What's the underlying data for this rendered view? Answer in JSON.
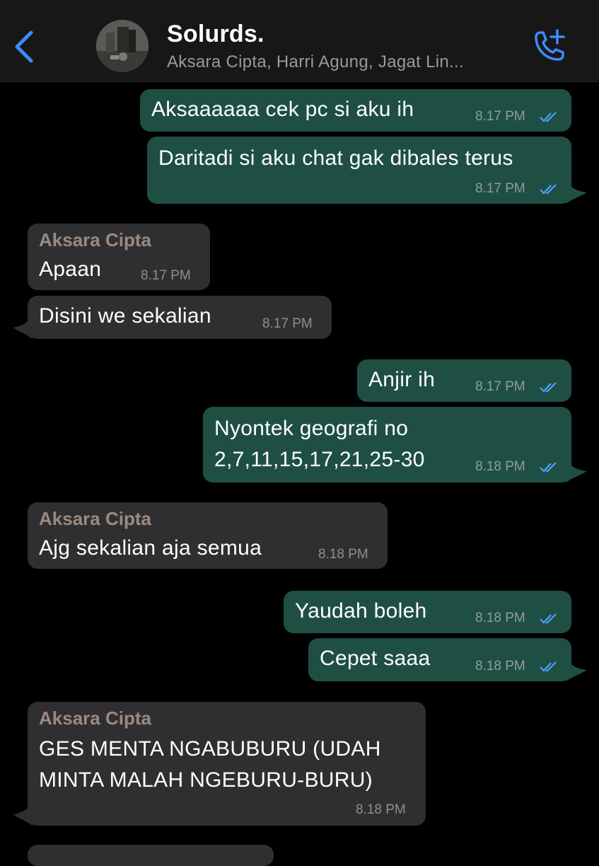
{
  "header": {
    "back_icon": "chevron-left-icon",
    "title": "Solurds.",
    "subtitle": "Aksara Cipta, Harri Agung, Jagat Lin...",
    "call_icon": "phone-plus-icon"
  },
  "colors": {
    "outgoing_bubble": "#1f4f43",
    "incoming_bubble": "#2f2f31",
    "sender_name": "#9b8a80",
    "accent": "#3d8bff"
  },
  "messages": [
    {
      "direction": "out",
      "text": "Aksaaaaaa cek pc si aku ih",
      "time": "8.17 PM",
      "status": "read"
    },
    {
      "direction": "out",
      "text": "Daritadi si aku chat gak dibales terus",
      "time": "8.17 PM",
      "status": "read"
    },
    {
      "direction": "in",
      "sender": "Aksara Cipta",
      "text": "Apaan",
      "time": "8.17 PM"
    },
    {
      "direction": "in",
      "text": "Disini we sekalian",
      "time": "8.17 PM"
    },
    {
      "direction": "out",
      "text": "Anjir ih",
      "time": "8.17 PM",
      "status": "read"
    },
    {
      "direction": "out",
      "text_lines": [
        "Nyontek geografi no",
        "2,7,11,15,17,21,25-30"
      ],
      "time": "8.18 PM",
      "status": "read"
    },
    {
      "direction": "in",
      "sender": "Aksara Cipta",
      "text": "Ajg sekalian aja semua",
      "time": "8.18 PM"
    },
    {
      "direction": "out",
      "text": "Yaudah boleh",
      "time": "8.18 PM",
      "status": "read"
    },
    {
      "direction": "out",
      "text": "Cepet saaa",
      "time": "8.18 PM",
      "status": "read"
    },
    {
      "direction": "in",
      "sender": "Aksara Cipta",
      "text_lines": [
        "GES MENTA NGABUBURU (UDAH",
        "MINTA MALAH NGEBURU-BURU)"
      ],
      "time": "8.18 PM"
    }
  ]
}
